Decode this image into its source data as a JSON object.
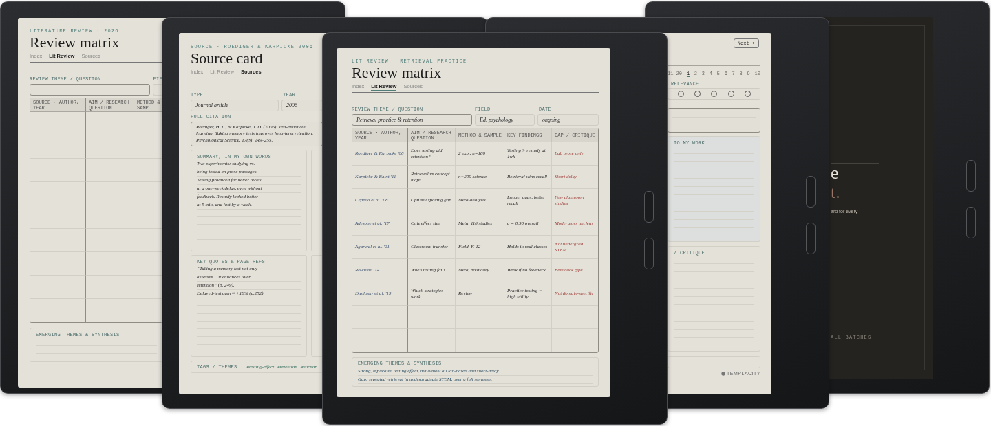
{
  "left_tablet": {
    "eyebrow": "LITERATURE REVIEW · 2026",
    "title": "Review matrix",
    "tabs": [
      {
        "label": "Index",
        "selected": false
      },
      {
        "label": "Lit Review",
        "selected": true
      },
      {
        "label": "Sources",
        "selected": false
      }
    ],
    "theme_label": "REVIEW THEME / QUESTION",
    "field_label": "FIE",
    "columns": [
      "SOURCE · AUTHOR, YEAR",
      "AIM / RESEARCH QUESTION",
      "METHOD & SAMP"
    ],
    "synthesis_label": "EMERGING THEMES & SYNTHESIS"
  },
  "source_tablet": {
    "eyebrow": "SOURCE · ROEDIGER & KARPICKE 2006",
    "title": "Source card",
    "tabs": [
      {
        "label": "Index",
        "selected": false
      },
      {
        "label": "Lit Review",
        "selected": false
      },
      {
        "label": "Sources",
        "selected": true
      }
    ],
    "type_label": "TYPE",
    "type_value": "Journal article",
    "year_label": "YEAR",
    "year_value": "2006",
    "citation_label": "FULL CITATION",
    "citation": "Roediger, H. L., & Karpicke, J. D. (2006). Test-enhanced learning: Taking memory tests improves long-term retention. Psychological Science, 17(3), 249–255.",
    "summary_label": "SUMMARY, IN MY OWN WORDS",
    "summary_lines": [
      "Two experiments: studying vs.",
      "being tested on prose passages.",
      "Testing produced far better recall",
      "at a one-week delay, even without",
      "feedback. Restudy looked better",
      "at 5 min, and lost by a week."
    ],
    "quotes_label": "KEY QUOTES & PAGE REFS",
    "quotes_lines": [
      "“Taking a memory test not only",
      "assesses… it enhances later",
      "retention” (p. 249).",
      "Delayed-test gain ≈ +18% (p.252)."
    ],
    "tags_label": "TAGS / THEMES",
    "tags": [
      "#testing-effect",
      "#retention",
      "#anchor"
    ]
  },
  "main_tablet": {
    "eyebrow": "LIT REVIEW · RETRIEVAL PRACTICE",
    "title": "Review matrix",
    "tabs": [
      {
        "label": "Index",
        "selected": false
      },
      {
        "label": "Lit Review",
        "selected": true
      },
      {
        "label": "Sources",
        "selected": false
      }
    ],
    "theme_label": "REVIEW THEME / QUESTION",
    "theme_value": "Retrieval practice & retention",
    "field_label": "FIELD",
    "field_value": "Ed. psychology",
    "date_label": "DATE",
    "date_value": "ongoing",
    "columns": [
      "SOURCE · AUTHOR, YEAR",
      "AIM / RESEARCH QUESTION",
      "METHOD & SAMPLE",
      "KEY FINDINGS",
      "GAP / CRITIQUE"
    ],
    "rows": [
      {
        "source": "Roediger & Karpicke '06",
        "aim": "Does testing aid retention?",
        "method": "2 exp., n=180",
        "findings": "Testing > restudy at 1wk",
        "gap": "Lab prose only"
      },
      {
        "source": "Karpicke & Blunt '11",
        "aim": "Retrieval vs concept maps",
        "method": "n=200 science",
        "findings": "Retrieval wins recall",
        "gap": "Short delay"
      },
      {
        "source": "Cepeda et al. '08",
        "aim": "Optimal spacing gap",
        "method": "Meta-analysis",
        "findings": "Longer gaps, better recall",
        "gap": "Few classroom studies"
      },
      {
        "source": "Adesope et al. '17",
        "aim": "Quiz effect size",
        "method": "Meta, 118 studies",
        "findings": "g = 0.50 overall",
        "gap": "Moderators unclear"
      },
      {
        "source": "Agarwal et al. '21",
        "aim": "Classroom transfer",
        "method": "Field, K-12",
        "findings": "Holds in real classes",
        "gap": "Not undergrad STEM"
      },
      {
        "source": "Rowland '14",
        "aim": "When testing fails",
        "method": "Meta, boundary",
        "findings": "Weak if no feedback",
        "gap": "Feedback type"
      },
      {
        "source": "Dunlosky et al. '13",
        "aim": "Which strategies work",
        "method": "Review",
        "findings": "Practice testing = high utility",
        "gap": "Not domain-specific"
      }
    ],
    "synthesis_label": "EMERGING THEMES & SYNTHESIS",
    "synthesis_lines": [
      "Strong, replicated testing effect, but almost all lab-based and short-delay.",
      "Gap: repeated retrieval in undergraduate STEM, over a full semester."
    ]
  },
  "right_tablet": {
    "next_button": "Next ›",
    "range": "11–20",
    "pages": [
      {
        "label": "1",
        "selected": true
      },
      {
        "label": "2",
        "selected": false
      },
      {
        "label": "3",
        "selected": false
      },
      {
        "label": "4",
        "selected": false
      },
      {
        "label": "5",
        "selected": false
      },
      {
        "label": "6",
        "selected": false
      },
      {
        "label": "7",
        "selected": false
      },
      {
        "label": "8",
        "selected": false
      },
      {
        "label": "9",
        "selected": false
      },
      {
        "label": "10",
        "selected": false
      }
    ],
    "relevance_label": "RELEVANCE",
    "relevance": [
      {
        "checked": false
      },
      {
        "checked": false
      },
      {
        "checked": false
      },
      {
        "checked": false
      },
      {
        "checked": false
      }
    ],
    "work_label": "TO MY WORK",
    "critique_label": "/ CRITIQUE",
    "brand": "TEMPLACITY"
  },
  "dark_tablet": {
    "heading_lines": [
      "e",
      "t."
    ],
    "body": "ard for every",
    "footer": "ALL BATCHES"
  }
}
